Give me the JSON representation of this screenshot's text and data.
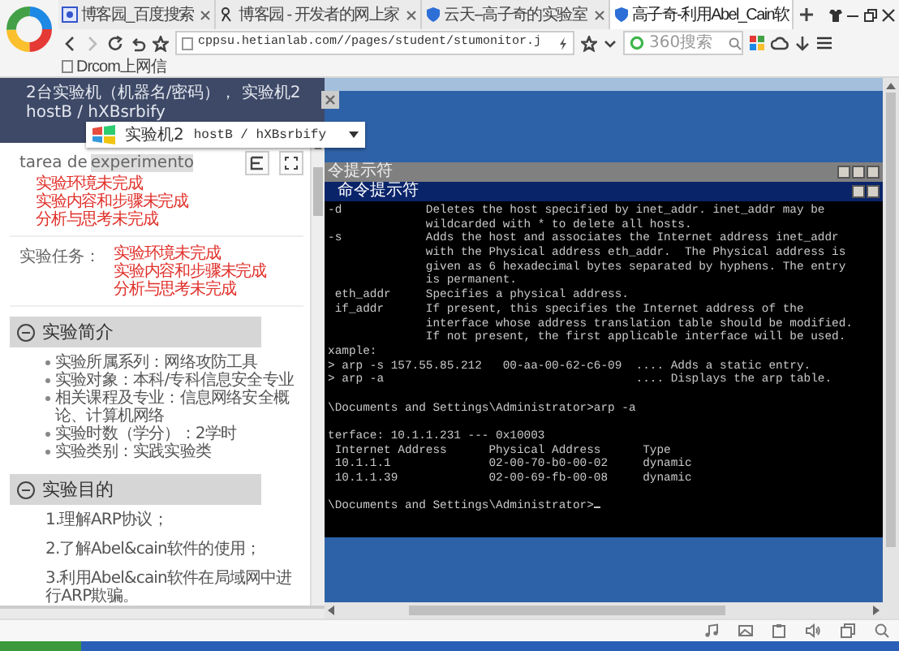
{
  "browser": {
    "tabs": [
      {
        "title": "博客园_百度搜索",
        "selected": false
      },
      {
        "title": "博客园 - 开发者的网上家",
        "selected": false
      },
      {
        "title": "云天--高子奇的实验室",
        "selected": false
      },
      {
        "title": "高子奇-利用Abel_Cain软",
        "selected": true
      }
    ],
    "address": {
      "url": "cppsu.hetianlab.com//pages/student/stumonitor.j"
    },
    "search": {
      "placeholder": "360搜索"
    },
    "bookmarks": [
      {
        "title": "Drcom上网信"
      }
    ]
  },
  "lab_panel": {
    "header": "2台实验机（机器名/密码）， 实验机2 hostB / hXBsrbify",
    "machine_select": {
      "label": "实验机2",
      "value": "hostB / hXBsrbify"
    },
    "tasks": [
      {
        "kind": "stacked",
        "label": "tarea de",
        "highlight": "experimento",
        "statuses": [
          "实验环境未完成",
          "实验内容和步骤未完成",
          "分析与思考未完成"
        ]
      },
      {
        "kind": "beside",
        "label": "实验任务：",
        "statuses": [
          "实验环境未完成",
          "实验内容和步骤未完成",
          "分析与思考未完成"
        ]
      }
    ],
    "sections": [
      {
        "title": "实验简介",
        "expanded": true,
        "kind": "bullets",
        "items": [
          "实验所属系列：网络攻防工具",
          "实验对象：本科/专科信息安全专业",
          "相关课程及专业：信息网络安全概论、计算机网络",
          "实验时数（学分）：2学时",
          "实验类别：实践实验类"
        ]
      },
      {
        "title": "实验目的",
        "expanded": true,
        "kind": "numbered",
        "items": [
          "1.理解ARP协议；",
          "2.了解Abel&cain软件的使用；",
          "3.利用Abel&cain软件在局域网中进行ARP欺骗。"
        ]
      }
    ]
  },
  "remote": {
    "outer_title": "令提示符",
    "console_title": "命令提示符",
    "blocks": [
      [
        "-d            Deletes the host specified by inet_addr. inet_addr may be",
        "              wildcarded with * to delete all hosts.",
        "-s            Adds the host and associates the Internet address inet_addr",
        "              with the Physical address eth_addr.  The Physical address is",
        "              given as 6 hexadecimal bytes separated by hyphens. The entry",
        "              is permanent.",
        " eth_addr     Specifies a physical address.",
        " if_addr      If present, this specifies the Internet address of the",
        "              interface whose address translation table should be modified.",
        "              If not present, the first applicable interface will be used.",
        "xample:",
        "> arp -s 157.55.85.212   00-aa-00-62-c6-09  .... Adds a static entry.",
        "> arp -a                                    .... Displays the arp table."
      ],
      [
        "\\Documents and Settings\\Administrator>arp -a"
      ],
      [
        "terface: 10.1.1.231 --- 0x10003",
        " Internet Address      Physical Address      Type",
        " 10.1.1.1              02-00-70-b0-00-02     dynamic",
        " 10.1.1.39             02-00-69-fb-00-08     dynamic"
      ],
      [
        "\\Documents and Settings\\Administrator>"
      ]
    ]
  }
}
